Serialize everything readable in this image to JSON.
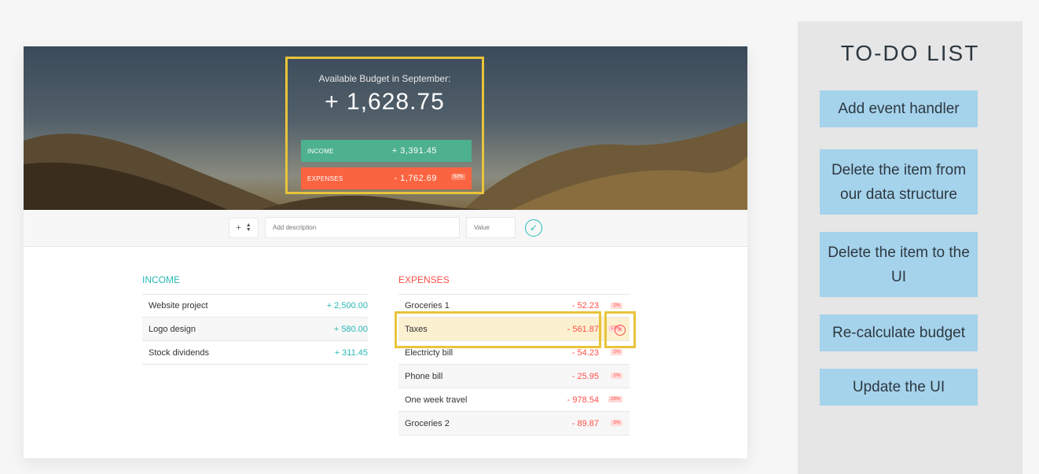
{
  "budget": {
    "title": "Available Budget in September:",
    "value": "+ 1,628.75",
    "income_label": "INCOME",
    "income_value": "+ 3,391.45",
    "expenses_label": "EXPENSES",
    "expenses_value": "- 1,762.69",
    "expenses_pct": "52%"
  },
  "add_form": {
    "type_value": "+",
    "description_placeholder": "Add description",
    "value_placeholder": "Value",
    "submit_icon": "check-circle-icon"
  },
  "income": {
    "title": "INCOME",
    "items": [
      {
        "description": "Website project",
        "value": "+ 2,500.00"
      },
      {
        "description": "Logo design",
        "value": "+ 580.00"
      },
      {
        "description": "Stock dividends",
        "value": "+ 311.45"
      }
    ]
  },
  "expenses": {
    "title": "EXPENSES",
    "items": [
      {
        "description": "Groceries 1",
        "value": "- 52.23",
        "pct": "2%"
      },
      {
        "description": "Taxes",
        "value": "- 561.87",
        "pct": "17%"
      },
      {
        "description": "Electricty bill",
        "value": "- 54.23",
        "pct": "2%"
      },
      {
        "description": "Phone bill",
        "value": "- 25.95",
        "pct": "1%"
      },
      {
        "description": "One week travel",
        "value": "- 978.54",
        "pct": "29%"
      },
      {
        "description": "Groceries 2",
        "value": "- 89.87",
        "pct": "3%"
      }
    ],
    "delete_icon": "close-circle-icon"
  },
  "todo": {
    "title": "TO-DO LIST",
    "items": [
      "Add event handler",
      "Delete the item from our data structure",
      "Delete the item to the UI",
      "Re-calculate budget",
      "Update the UI"
    ]
  },
  "colors": {
    "income": "#28b9b5",
    "expenses": "#ff5049",
    "highlight": "#e8c43a",
    "todo_item": "#a6d3ec"
  }
}
